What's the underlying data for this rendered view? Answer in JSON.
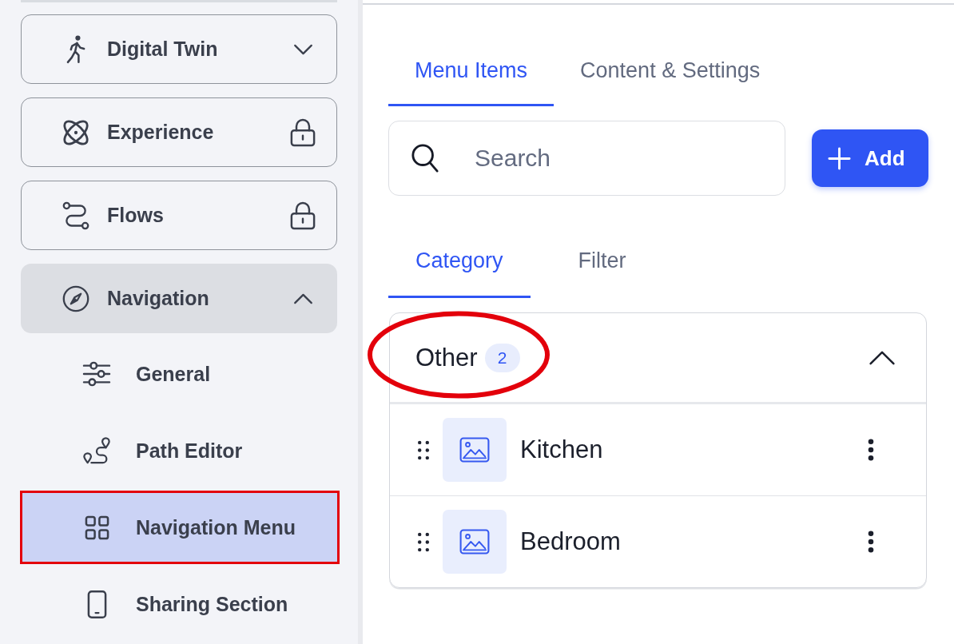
{
  "sidebar": {
    "items": [
      {
        "label": "Digital Twin",
        "kind": "expandable",
        "expanded": false
      },
      {
        "label": "Experience",
        "kind": "locked"
      },
      {
        "label": "Flows",
        "kind": "locked"
      },
      {
        "label": "Navigation",
        "kind": "expandable",
        "expanded": true,
        "children": [
          {
            "label": "General",
            "selected": false,
            "annotated": false
          },
          {
            "label": "Path Editor",
            "selected": false,
            "annotated": false
          },
          {
            "label": "Navigation Menu",
            "selected": true,
            "annotated": true
          },
          {
            "label": "Sharing Section",
            "selected": false,
            "annotated": false
          }
        ]
      }
    ]
  },
  "content": {
    "tabs": [
      {
        "label": "Menu Items",
        "selected": true
      },
      {
        "label": "Content & Settings",
        "selected": false
      }
    ],
    "search": {
      "placeholder": "Search"
    },
    "add_button": {
      "label": "Add"
    },
    "view_tabs": [
      {
        "label": "Category",
        "selected": true
      },
      {
        "label": "Filter",
        "selected": false
      }
    ],
    "category_group": {
      "title": "Other",
      "count": "2",
      "expanded": true,
      "annotated": true,
      "items": [
        {
          "label": "Kitchen"
        },
        {
          "label": "Bedroom"
        }
      ]
    }
  }
}
